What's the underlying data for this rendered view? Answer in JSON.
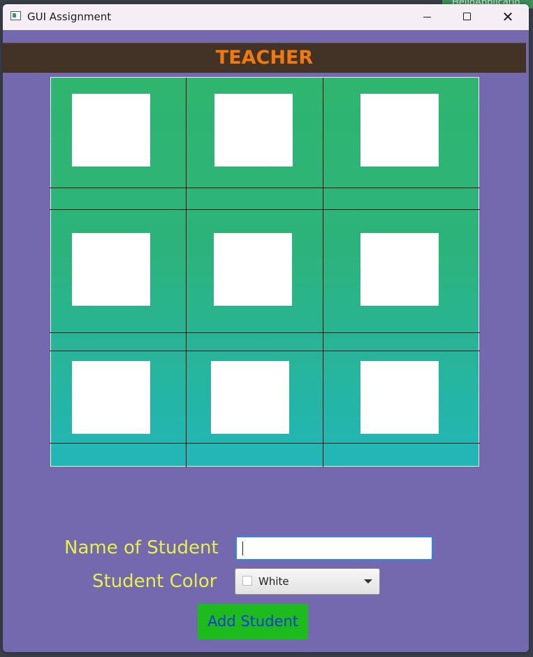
{
  "background": {
    "peek_text": "HelloApplicatio"
  },
  "window": {
    "title": "GUI Assignment",
    "controls": {
      "close_glyph": "✕"
    }
  },
  "header": {
    "title": "TEACHER"
  },
  "colors": {
    "window_bg": "#7469ae",
    "header_bg": "#433327",
    "header_text": "#f07a10",
    "grid_top": "#2fb56e",
    "grid_bottom": "#22b6b8",
    "label_text": "#e8f04a",
    "button_bg": "#1dbb1d",
    "button_text": "#1a3bd6"
  },
  "form": {
    "name_label": "Name of Student",
    "name_value": "",
    "color_label": "Student Color",
    "color_selected": "White",
    "add_button": "Add Student"
  }
}
